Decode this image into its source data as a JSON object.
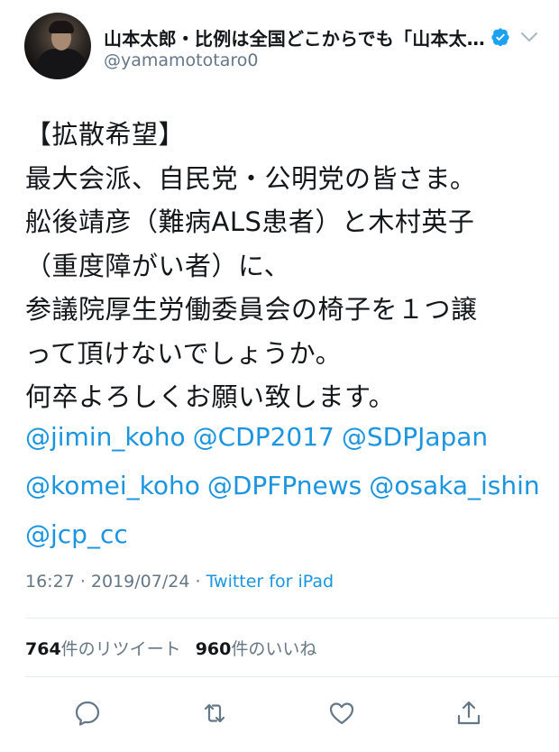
{
  "author": {
    "display_name": "山本太郎・比例は全国どこからでも「山本太…",
    "handle": "@yamamototaro0",
    "verified": true
  },
  "tweet": {
    "lines": [
      "【拡散希望】",
      "最大会派、自民党・公明党の皆さま。",
      "舩後靖彦（難病ALS患者）と木村英子",
      "（重度障がい者）に、",
      "参議院厚生労働委員会の椅子を１つ譲",
      "って頂けないでしょうか。",
      "何卒よろしくお願い致します。"
    ],
    "mention_lines": [
      [
        "@jimin_koho",
        "@CDP2017",
        "@SDPJapan"
      ],
      [
        "@komei_koho",
        "@DPFPnews",
        "@osaka_ishin"
      ],
      [
        "@jcp_cc"
      ]
    ]
  },
  "meta": {
    "time": "16:27",
    "date": "2019/07/24",
    "separator": "·",
    "source": "Twitter for iPad"
  },
  "stats": {
    "retweets_count": "764",
    "retweets_label": "件のリツイート",
    "likes_count": "960",
    "likes_label": "件のいいね"
  },
  "actions": [
    "reply-icon",
    "retweet-icon",
    "like-icon",
    "share-icon"
  ],
  "colors": {
    "link": "#1b95e0",
    "secondary_text": "#657786",
    "primary_text": "#14171a",
    "divider": "#e6ecf0"
  }
}
